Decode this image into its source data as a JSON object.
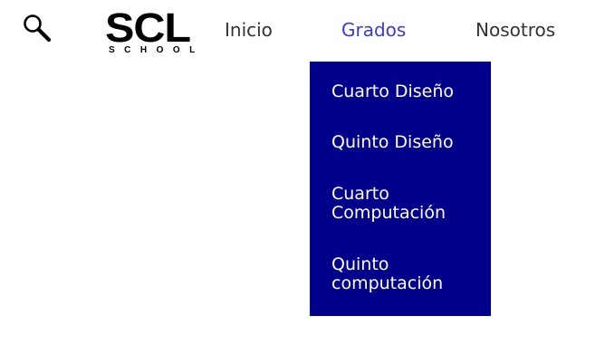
{
  "header": {
    "search_icon": "search-icon",
    "logo": {
      "main": "SCL",
      "sub": "SCHOOL"
    },
    "nav": {
      "inicio": "Inicio",
      "grados": "Grados",
      "nosotros": "Nosotros"
    },
    "active_color": "#3a3ad8"
  },
  "dropdown": {
    "background": "#00008b",
    "items": [
      {
        "lines": [
          "Cuarto Diseño"
        ]
      },
      {
        "lines": [
          "Quinto Diseño"
        ]
      },
      {
        "lines": [
          "Cuarto",
          "Computación"
        ]
      },
      {
        "lines": [
          "Quinto",
          "computación"
        ]
      }
    ]
  }
}
